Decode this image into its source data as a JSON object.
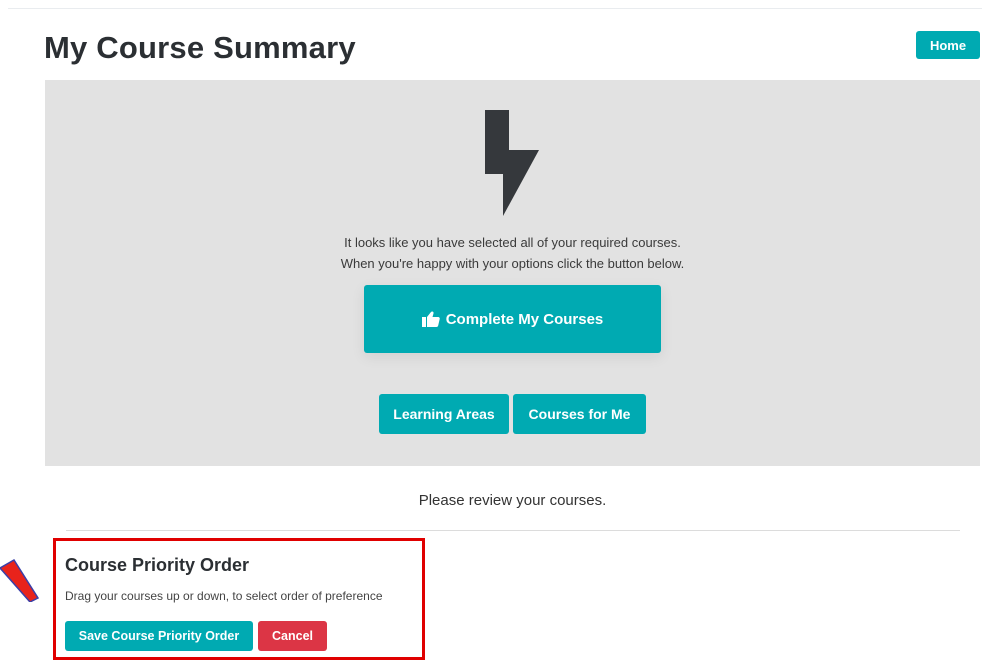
{
  "header": {
    "title": "My Course Summary",
    "home_label": "Home"
  },
  "summary_panel": {
    "icon": "lightning-bolt-icon",
    "message_line1": "It looks like you have selected all of your required courses.",
    "message_line2": "When you're happy with your options click the button below.",
    "complete_label": "Complete My Courses",
    "complete_icon": "thumbs-up-icon",
    "learning_areas_label": "Learning Areas",
    "courses_for_me_label": "Courses for Me"
  },
  "review": {
    "text": "Please review your courses."
  },
  "priority": {
    "title": "Course Priority Order",
    "description": "Drag your courses up or down, to select order of preference",
    "save_label": "Save Course Priority Order",
    "cancel_label": "Cancel"
  },
  "colors": {
    "accent": "#00aab2",
    "danger": "#dc3545",
    "highlight_border": "#e00000",
    "annotation_arrow": "#e8231b"
  }
}
